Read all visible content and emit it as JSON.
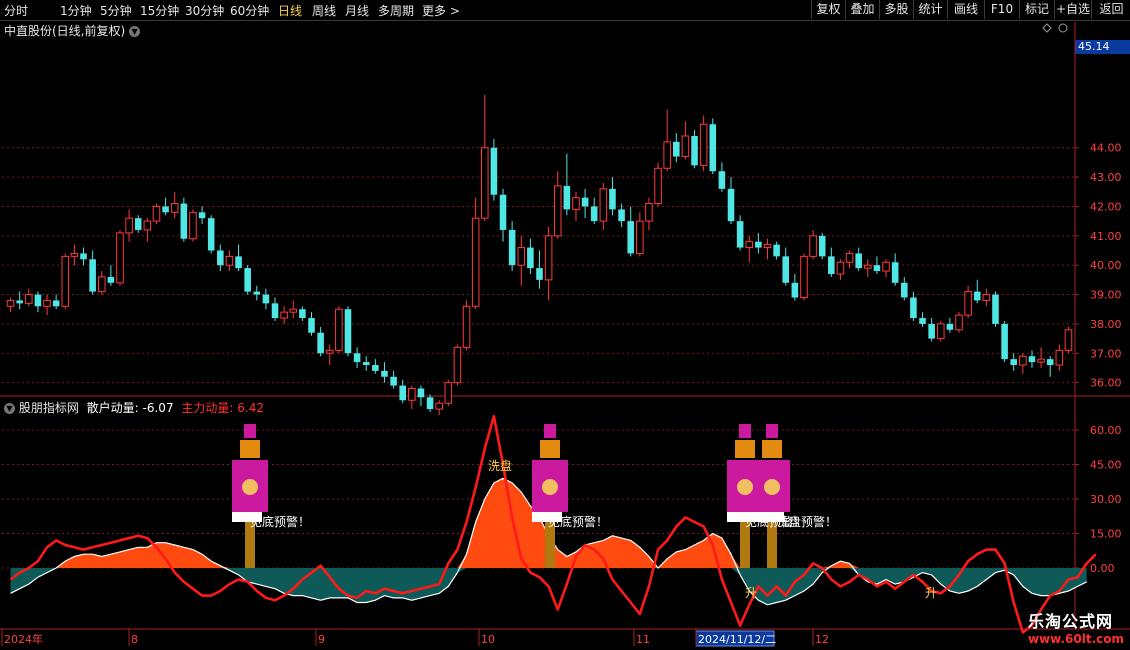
{
  "toolbar": {
    "periods": [
      "分时",
      "1分钟",
      "5分钟",
      "15分钟",
      "30分钟",
      "60分钟",
      "日线",
      "周线",
      "月线",
      "多周期",
      "更多 >"
    ],
    "active": "日线",
    "buttons": [
      "复权",
      "叠加",
      "多股",
      "统计",
      "画线",
      "F10",
      "标记",
      "+自选",
      "返回"
    ]
  },
  "chart_title": "中直股份(日线,前复权)",
  "last_price_tag": "45.14",
  "indicator": {
    "name": "股朋指标网",
    "retail_label": "散户动量: -6.07",
    "main_label": "主力动量: 6.42"
  },
  "annotations": [
    "洗盘",
    "见底预警！",
    "见底预警！",
    "见底预警！",
    "洗盘预警！",
    "升",
    "升"
  ],
  "x_axis_labels": [
    "2024年",
    "8",
    "9",
    "10",
    "11",
    "2024/11/12/二",
    "12"
  ],
  "watermark": {
    "line1": "乐淘公式网",
    "line2": "www.60lt.com"
  },
  "colors": {
    "up": "#ff3a3a",
    "down": "#4fe6e6",
    "main_fill": "#ff4a10",
    "retail_fill": "#0e5a58",
    "grid": "#7a1a1a"
  },
  "chart_data": [
    {
      "type": "candlestick",
      "title": "中直股份(日线,前复权)",
      "ylim": [
        35,
        46
      ],
      "yticks": [
        36,
        37,
        38,
        39,
        40,
        41,
        42,
        43,
        44
      ],
      "ohlc": [
        [
          38.6,
          38.9,
          38.4,
          38.8
        ],
        [
          38.8,
          39.1,
          38.5,
          38.7
        ],
        [
          38.7,
          39.2,
          38.6,
          39.0
        ],
        [
          39.0,
          39.1,
          38.4,
          38.6
        ],
        [
          38.6,
          39.0,
          38.3,
          38.8
        ],
        [
          38.8,
          39.0,
          38.5,
          38.6
        ],
        [
          38.6,
          40.4,
          38.5,
          40.3
        ],
        [
          40.3,
          40.7,
          40.0,
          40.4
        ],
        [
          40.4,
          40.6,
          40.0,
          40.2
        ],
        [
          40.2,
          40.5,
          39.0,
          39.1
        ],
        [
          39.1,
          39.8,
          39.0,
          39.6
        ],
        [
          39.6,
          40.0,
          39.3,
          39.4
        ],
        [
          39.4,
          41.2,
          39.3,
          41.1
        ],
        [
          41.1,
          41.9,
          40.8,
          41.6
        ],
        [
          41.6,
          41.7,
          41.1,
          41.2
        ],
        [
          41.2,
          41.6,
          40.8,
          41.5
        ],
        [
          41.5,
          42.1,
          41.4,
          42.0
        ],
        [
          42.0,
          42.3,
          41.7,
          41.8
        ],
        [
          41.8,
          42.5,
          41.6,
          42.1
        ],
        [
          42.1,
          42.3,
          40.8,
          40.9
        ],
        [
          40.9,
          41.9,
          40.8,
          41.8
        ],
        [
          41.8,
          42.0,
          41.4,
          41.6
        ],
        [
          41.6,
          41.7,
          40.4,
          40.5
        ],
        [
          40.5,
          40.7,
          39.8,
          40.0
        ],
        [
          40.0,
          40.5,
          39.8,
          40.3
        ],
        [
          40.3,
          40.7,
          39.8,
          39.9
        ],
        [
          39.9,
          40.0,
          39.0,
          39.1
        ],
        [
          39.1,
          39.3,
          38.8,
          39.0
        ],
        [
          39.0,
          39.2,
          38.5,
          38.7
        ],
        [
          38.7,
          38.9,
          38.1,
          38.2
        ],
        [
          38.2,
          38.6,
          38.0,
          38.4
        ],
        [
          38.4,
          38.8,
          38.2,
          38.5
        ],
        [
          38.5,
          38.6,
          38.1,
          38.2
        ],
        [
          38.2,
          38.4,
          37.6,
          37.7
        ],
        [
          37.7,
          37.9,
          36.9,
          37.0
        ],
        [
          37.0,
          37.3,
          36.6,
          37.1
        ],
        [
          37.1,
          38.6,
          37.0,
          38.5
        ],
        [
          38.5,
          38.6,
          36.9,
          37.0
        ],
        [
          37.0,
          37.2,
          36.5,
          36.7
        ],
        [
          36.7,
          36.9,
          36.4,
          36.6
        ],
        [
          36.6,
          36.8,
          36.3,
          36.4
        ],
        [
          36.4,
          36.7,
          36.0,
          36.2
        ],
        [
          36.2,
          36.4,
          35.8,
          35.9
        ],
        [
          35.9,
          36.1,
          35.3,
          35.4
        ],
        [
          35.4,
          35.9,
          35.1,
          35.8
        ],
        [
          35.8,
          35.9,
          35.2,
          35.5
        ],
        [
          35.5,
          35.6,
          35.0,
          35.1
        ],
        [
          35.1,
          35.4,
          34.9,
          35.3
        ],
        [
          35.3,
          36.1,
          35.2,
          36.0
        ],
        [
          36.0,
          37.3,
          35.9,
          37.2
        ],
        [
          37.2,
          38.8,
          37.1,
          38.6
        ],
        [
          38.6,
          42.3,
          38.5,
          41.6
        ],
        [
          41.6,
          45.8,
          41.5,
          44.0
        ],
        [
          44.0,
          44.3,
          42.2,
          42.4
        ],
        [
          42.4,
          42.6,
          40.8,
          41.2
        ],
        [
          41.2,
          41.5,
          39.8,
          40.0
        ],
        [
          40.0,
          41.0,
          39.3,
          40.6
        ],
        [
          40.6,
          40.9,
          39.7,
          39.9
        ],
        [
          39.9,
          40.5,
          39.2,
          39.5
        ],
        [
          39.5,
          41.3,
          38.8,
          41.0
        ],
        [
          41.0,
          43.2,
          40.9,
          42.7
        ],
        [
          42.7,
          43.8,
          41.7,
          41.9
        ],
        [
          41.9,
          42.5,
          41.5,
          42.3
        ],
        [
          42.3,
          42.6,
          41.6,
          42.0
        ],
        [
          42.0,
          42.3,
          41.4,
          41.5
        ],
        [
          41.5,
          42.8,
          41.2,
          42.6
        ],
        [
          42.6,
          43.0,
          41.7,
          41.9
        ],
        [
          41.9,
          42.1,
          41.3,
          41.5
        ],
        [
          41.5,
          42.0,
          40.3,
          40.4
        ],
        [
          40.4,
          41.8,
          40.3,
          41.5
        ],
        [
          41.5,
          42.3,
          41.2,
          42.1
        ],
        [
          42.1,
          43.5,
          42.0,
          43.3
        ],
        [
          43.3,
          45.3,
          43.2,
          44.2
        ],
        [
          44.2,
          44.5,
          43.5,
          43.7
        ],
        [
          43.7,
          44.9,
          43.6,
          44.4
        ],
        [
          44.4,
          44.6,
          43.3,
          43.4
        ],
        [
          43.4,
          45.1,
          43.2,
          44.8
        ],
        [
          44.8,
          45.0,
          43.1,
          43.2
        ],
        [
          43.2,
          43.5,
          42.5,
          42.6
        ],
        [
          42.6,
          43.0,
          41.4,
          41.5
        ],
        [
          41.5,
          41.7,
          40.5,
          40.6
        ],
        [
          40.6,
          41.0,
          40.1,
          40.8
        ],
        [
          40.8,
          41.1,
          40.4,
          40.6
        ],
        [
          40.6,
          40.9,
          40.2,
          40.7
        ],
        [
          40.7,
          40.8,
          40.2,
          40.3
        ],
        [
          40.3,
          40.6,
          39.3,
          39.4
        ],
        [
          39.4,
          39.7,
          38.8,
          38.9
        ],
        [
          38.9,
          40.4,
          38.8,
          40.3
        ],
        [
          40.3,
          41.2,
          40.2,
          41.0
        ],
        [
          41.0,
          41.1,
          40.2,
          40.3
        ],
        [
          40.3,
          40.6,
          39.6,
          39.7
        ],
        [
          39.7,
          40.2,
          39.5,
          40.1
        ],
        [
          40.1,
          40.5,
          39.9,
          40.4
        ],
        [
          40.4,
          40.6,
          39.8,
          39.9
        ],
        [
          39.9,
          40.2,
          39.6,
          40.0
        ],
        [
          40.0,
          40.3,
          39.7,
          39.8
        ],
        [
          39.8,
          40.2,
          39.6,
          40.1
        ],
        [
          40.1,
          40.4,
          39.3,
          39.4
        ],
        [
          39.4,
          39.6,
          38.8,
          38.9
        ],
        [
          38.9,
          39.1,
          38.1,
          38.2
        ],
        [
          38.2,
          38.4,
          37.9,
          38.0
        ],
        [
          38.0,
          38.2,
          37.4,
          37.5
        ],
        [
          37.5,
          38.1,
          37.4,
          38.0
        ],
        [
          38.0,
          38.2,
          37.7,
          37.8
        ],
        [
          37.8,
          38.4,
          37.7,
          38.3
        ],
        [
          38.3,
          39.3,
          38.2,
          39.1
        ],
        [
          39.1,
          39.5,
          38.7,
          38.8
        ],
        [
          38.8,
          39.2,
          38.6,
          39.0
        ],
        [
          39.0,
          39.1,
          37.9,
          38.0
        ],
        [
          38.0,
          38.1,
          36.7,
          36.8
        ],
        [
          36.8,
          37.0,
          36.4,
          36.6
        ],
        [
          36.6,
          37.0,
          36.3,
          36.9
        ],
        [
          36.9,
          37.1,
          36.5,
          36.7
        ],
        [
          36.7,
          37.2,
          36.5,
          36.8
        ],
        [
          36.8,
          36.9,
          36.2,
          36.6
        ],
        [
          36.6,
          37.3,
          36.4,
          37.1
        ],
        [
          37.1,
          37.9,
          37.0,
          37.8
        ]
      ]
    },
    {
      "type": "area",
      "title": "股朋指标网",
      "ylim": [
        -25,
        70
      ],
      "yticks": [
        0,
        15,
        30,
        45,
        60
      ],
      "series": [
        {
          "name": "散户动量",
          "value": -6.07,
          "values": [
            -11,
            -9,
            -7,
            -4,
            -2,
            0,
            3,
            5,
            6,
            6,
            5,
            6,
            7,
            8,
            9,
            9,
            11,
            11,
            10,
            9,
            8,
            6,
            3,
            1,
            -1,
            -3,
            -6,
            -7,
            -8,
            -9,
            -11,
            -12,
            -12,
            -13,
            -14,
            -13,
            -13,
            -13,
            -15,
            -15,
            -14,
            -12,
            -13,
            -13,
            -14,
            -13,
            -12,
            -11,
            -8,
            -2,
            6,
            20,
            30,
            37,
            39,
            37,
            33,
            27,
            22,
            14,
            8,
            5,
            7,
            10,
            11,
            12,
            14,
            13,
            12,
            9,
            5,
            0,
            4,
            7,
            8,
            10,
            12,
            15,
            13,
            6,
            -3,
            -10,
            -14,
            -16,
            -15,
            -14,
            -12,
            -10,
            -7,
            -2,
            1,
            3,
            2,
            -3,
            -6,
            -7,
            -5,
            -7,
            -6,
            -4,
            -2,
            -3,
            -7,
            -10,
            -11,
            -10,
            -8,
            -5,
            -2,
            -1,
            -3,
            -8,
            -11,
            -12,
            -12,
            -11,
            -10,
            -8,
            -6
          ]
        },
        {
          "name": "主力动量",
          "value": 6.42,
          "values": [
            -5,
            -2,
            0,
            3,
            9,
            12,
            10,
            9,
            8,
            9,
            10,
            11,
            12,
            13,
            14,
            13,
            9,
            4,
            -2,
            -6,
            -9,
            -12,
            -12,
            -10,
            -7,
            -5,
            -6,
            -10,
            -13,
            -14,
            -12,
            -9,
            -5,
            -2,
            1,
            -4,
            -9,
            -12,
            -13,
            -10,
            -11,
            -9,
            -10,
            -11,
            -10,
            -9,
            -8,
            -7,
            2,
            8,
            20,
            35,
            52,
            66,
            45,
            22,
            4,
            -2,
            -4,
            -8,
            -18,
            -7,
            5,
            10,
            8,
            4,
            -5,
            -10,
            -15,
            -20,
            -8,
            8,
            12,
            18,
            22,
            20,
            18,
            10,
            -5,
            -15,
            -25,
            -16,
            -8,
            -12,
            -8,
            -12,
            -6,
            -3,
            2,
            0,
            -5,
            -8,
            -6,
            -3,
            -5,
            -8,
            -6,
            -9,
            -6,
            -3,
            -6,
            -10,
            -11,
            -8,
            -3,
            3,
            6,
            8,
            8,
            2,
            -15,
            -28,
            -25,
            -18,
            -12,
            -10,
            -5,
            -4,
            2,
            6
          ]
        }
      ]
    }
  ]
}
